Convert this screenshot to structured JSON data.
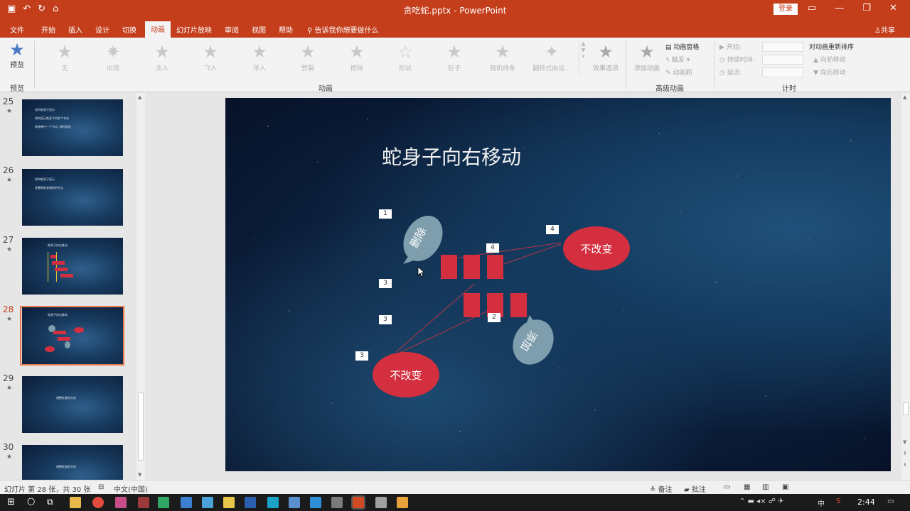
{
  "window": {
    "title": "贪吃蛇.pptx - PowerPoint",
    "login_label": "登录",
    "controls": [
      "▭",
      "—",
      "❐",
      "✕"
    ]
  },
  "ribbon_tabs": [
    {
      "label": "文件",
      "active": false
    },
    {
      "label": "开始",
      "active": false
    },
    {
      "label": "插入",
      "active": false
    },
    {
      "label": "设计",
      "active": false
    },
    {
      "label": "切换",
      "active": false
    },
    {
      "label": "动画",
      "active": true
    },
    {
      "label": "幻灯片放映",
      "active": false
    },
    {
      "label": "审阅",
      "active": false
    },
    {
      "label": "视图",
      "active": false
    },
    {
      "label": "帮助",
      "active": false
    }
  ],
  "tell_me": "告诉我你想要做什么",
  "share_label": "共享",
  "ribbon": {
    "preview_button": "预览",
    "preview_group": "预览",
    "animation_group": "动画",
    "advanced_group": "高级动画",
    "timing_group": "计时",
    "animations": [
      "无",
      "出现",
      "淡入",
      "飞入",
      "浮入",
      "劈裂",
      "擦除",
      "形状",
      "轮子",
      "随机线条",
      "翻转式由远..."
    ],
    "effect_options": "效果选项",
    "add_animation": "添加动画",
    "animation_pane": "动画窗格",
    "trigger": "触发",
    "animation_painter": "动画刷",
    "start_label": "开始:",
    "duration_label": "持续时间:",
    "delay_label": "延迟:",
    "reorder_title": "对动画重新排序",
    "move_earlier": "向前移动",
    "move_later": "向后移动"
  },
  "thumbnails": [
    {
      "num": "25",
      "lines": [
        "如何蛇身子显示",
        "如何显示蛇身子的多个节点",
        "新增单行一个节点, 同时加强"
      ]
    },
    {
      "num": "26",
      "lines": [
        "如何蛇身子显示",
        "轮番制蛇来制蛇的节点"
      ]
    },
    {
      "num": "27",
      "lines": [
        "蛇身子向右移动"
      ]
    },
    {
      "num": "28",
      "lines": [
        "蛇身子向右移动"
      ]
    },
    {
      "num": "29",
      "lines": [
        "调整蛇身的方向"
      ]
    },
    {
      "num": "30",
      "lines": [
        "调整蛇身的方向"
      ]
    }
  ],
  "slide": {
    "title": "蛇身子向右移动",
    "callout_delete": "删除",
    "callout_add": "添加",
    "unchanged_top": "不改变",
    "unchanged_bottom": "不改变",
    "markers": [
      "1",
      "4",
      "4",
      "3",
      "3",
      "2",
      "3"
    ]
  },
  "statusbar": {
    "slide_info": "幻灯片 第 28 张，共 30 张",
    "language": "中文(中国)",
    "notes": "备注",
    "comments": "批注"
  },
  "taskbar": {
    "time": "2:44",
    "ime": "中"
  },
  "colors": {
    "accent": "#c43e1c",
    "snake_red": "#d32f3f",
    "callout": "#7f9ead"
  }
}
